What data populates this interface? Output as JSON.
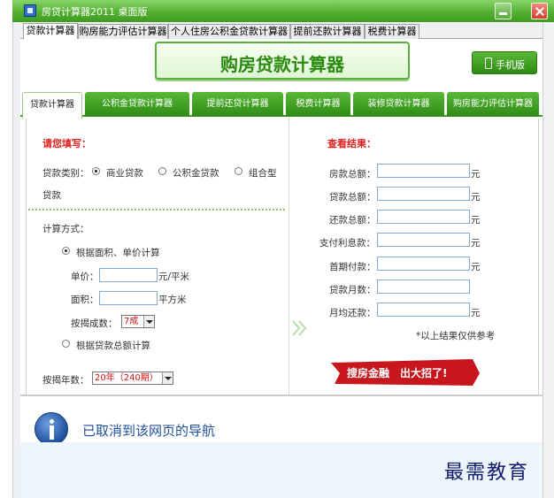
{
  "window": {
    "title": "房贷计算器2011 桌面版"
  },
  "top_tabs": [
    {
      "label": "贷款计算器",
      "active": true
    },
    {
      "label": "购房能力评估计算器",
      "active": false
    },
    {
      "label": "个人住房公积金贷款计算器",
      "active": false
    },
    {
      "label": "提前还款计算器",
      "active": false
    },
    {
      "label": "税费计算器",
      "active": false
    }
  ],
  "banner": {
    "title": "购房贷款计算器"
  },
  "mobile_button": {
    "label": "手机版"
  },
  "green_tabs": [
    {
      "label": "贷款计算器",
      "active": true
    },
    {
      "label": "公积金贷款计算器",
      "active": false
    },
    {
      "label": "提前还贷计算器",
      "active": false
    },
    {
      "label": "税费计算器",
      "active": false
    },
    {
      "label": "装修贷款计算器",
      "active": false
    },
    {
      "label": "购房能力评估计算器",
      "active": false
    }
  ],
  "left": {
    "heading": "请您填写：",
    "loan_type_label": "贷款类别：",
    "loan_types": [
      {
        "label": "商业贷款",
        "checked": true
      },
      {
        "label": "公积金贷款",
        "checked": false
      },
      {
        "label": "组合型",
        "checked": false
      }
    ],
    "loan_type_wrap": "贷款",
    "calc_method_label": "计算方式：",
    "method_area": "根据面积、单价计算",
    "unit_price_label": "单价：",
    "unit_price_unit": "元/平米",
    "area_label": "面积：",
    "area_unit": "平方米",
    "mortgage_ratio_label": "按揭成数：",
    "mortgage_ratio_value": "7成",
    "method_total": "根据贷款总额计算",
    "mortgage_years_label": "按揭年数：",
    "mortgage_years_value": "20年（240期）"
  },
  "right": {
    "heading": "查看结果：",
    "rows": [
      {
        "label": "房款总额：",
        "unit": "元"
      },
      {
        "label": "贷款总额：",
        "unit": "元"
      },
      {
        "label": "还款总额：",
        "unit": "元"
      },
      {
        "label": "支付利息款：",
        "unit": "元"
      },
      {
        "label": "首期付款：",
        "unit": "元"
      },
      {
        "label": "贷款月数：",
        "unit": ""
      },
      {
        "label": "月均还款：",
        "unit": "元"
      }
    ],
    "note": "*以上结果仅供参考",
    "promo": "搜房金融　出大招了!"
  },
  "nav_error": {
    "message": "已取消到该网页的导航"
  },
  "watermark": "最需教育",
  "colors": {
    "green": "#3d9a20",
    "red": "#e02020",
    "link_blue": "#1f4f9a"
  }
}
